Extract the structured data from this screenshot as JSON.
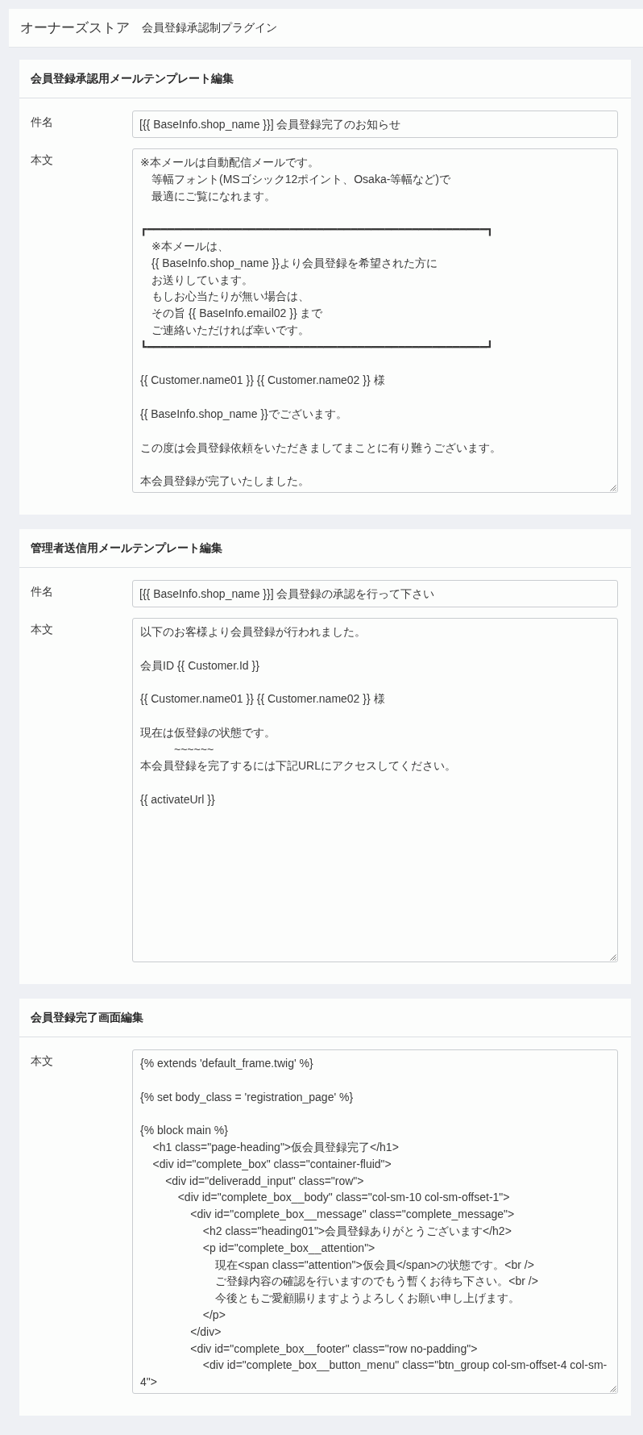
{
  "header": {
    "title": "オーナーズストア",
    "subtitle": "会員登録承認制プラグイン"
  },
  "sections": [
    {
      "title": "会員登録承認用メールテンプレート編集",
      "fields": [
        {
          "kind": "input",
          "label": "件名",
          "value": "[{{ BaseInfo.shop_name }}] 会員登録完了のお知らせ"
        },
        {
          "kind": "textarea",
          "label": "本文",
          "paragraphs": [
            [
              "※本メールは自動配信メールです。",
              "　等幅フォント(MSゴシック12ポイント、Osaka-等幅など)で",
              "　最適にご覧になれます。"
            ],
            [
              "┏━━━━━━━━━━━━━━━━━━━━━━━━━━━━━━━━━━━━━━━━━━━━━━━━━━┓",
              "　※本メールは、",
              "　{{ BaseInfo.shop_name }}より会員登録を希望された方に",
              "　お送りしています。",
              "　もしお心当たりが無い場合は、",
              "　その旨 {{ BaseInfo.email02 }} まで",
              "　ご連絡いただければ幸いです。",
              "┗━━━━━━━━━━━━━━━━━━━━━━━━━━━━━━━━━━━━━━━━━━━━━━━━━━┛"
            ],
            [
              "{{ Customer.name01 }} {{ Customer.name02 }} 様"
            ],
            [
              "{{ BaseInfo.shop_name }}でございます。"
            ],
            [
              "この度は会員登録依頼をいただきましてまことに有り難うございます。"
            ],
            [
              "本会員登録が完了いたしました。"
            ]
          ]
        }
      ]
    },
    {
      "title": "管理者送信用メールテンプレート編集",
      "fields": [
        {
          "kind": "input",
          "label": "件名",
          "value": "[{{ BaseInfo.shop_name }}] 会員登録の承認を行って下さい"
        },
        {
          "kind": "textarea",
          "label": "本文",
          "paragraphs": [
            [
              "以下のお客様より会員登録が行われました。"
            ],
            [
              "会員ID {{ Customer.Id }}"
            ],
            [
              "{{ Customer.name01 }} {{ Customer.name02 }} 様"
            ],
            [
              "現在は仮登録の状態です。",
              "　　　~~~~~~",
              "本会員登録を完了するには下記URLにアクセスしてください。"
            ],
            [
              "{{ activateUrl }}"
            ]
          ]
        }
      ]
    },
    {
      "title": "会員登録完了画面編集",
      "fields": [
        {
          "kind": "textarea",
          "label": "本文",
          "paragraphs": [
            [
              "{% extends 'default_frame.twig' %}"
            ],
            [
              "{% set body_class = 'registration_page' %}"
            ],
            [
              "{% block main %}",
              "    <h1 class=\"page-heading\">仮会員登録完了</h1>",
              "    <div id=\"complete_box\" class=\"container-fluid\">",
              "        <div id=\"deliveradd_input\" class=\"row\">",
              "            <div id=\"complete_box__body\" class=\"col-sm-10 col-sm-offset-1\">",
              "                <div id=\"complete_box__message\" class=\"complete_message\">",
              "                    <h2 class=\"heading01\">会員登録ありがとうございます</h2>",
              "                    <p id=\"complete_box__attention\">",
              "                        現在<span class=\"attention\">仮会員</span>の状態です。<br />",
              "                        ご登録内容の確認を行いますのでもう暫くお待ち下さい。<br />",
              "                        今後ともご愛顧賜りますようよろしくお願い申し上げます。",
              "                    </p>",
              "                </div>",
              "                <div id=\"complete_box__footer\" class=\"row no-padding\">",
              "                    <div id=\"complete_box__button_menu\" class=\"btn_group col-sm-offset-4 col-sm-4\">"
            ]
          ]
        }
      ]
    }
  ]
}
